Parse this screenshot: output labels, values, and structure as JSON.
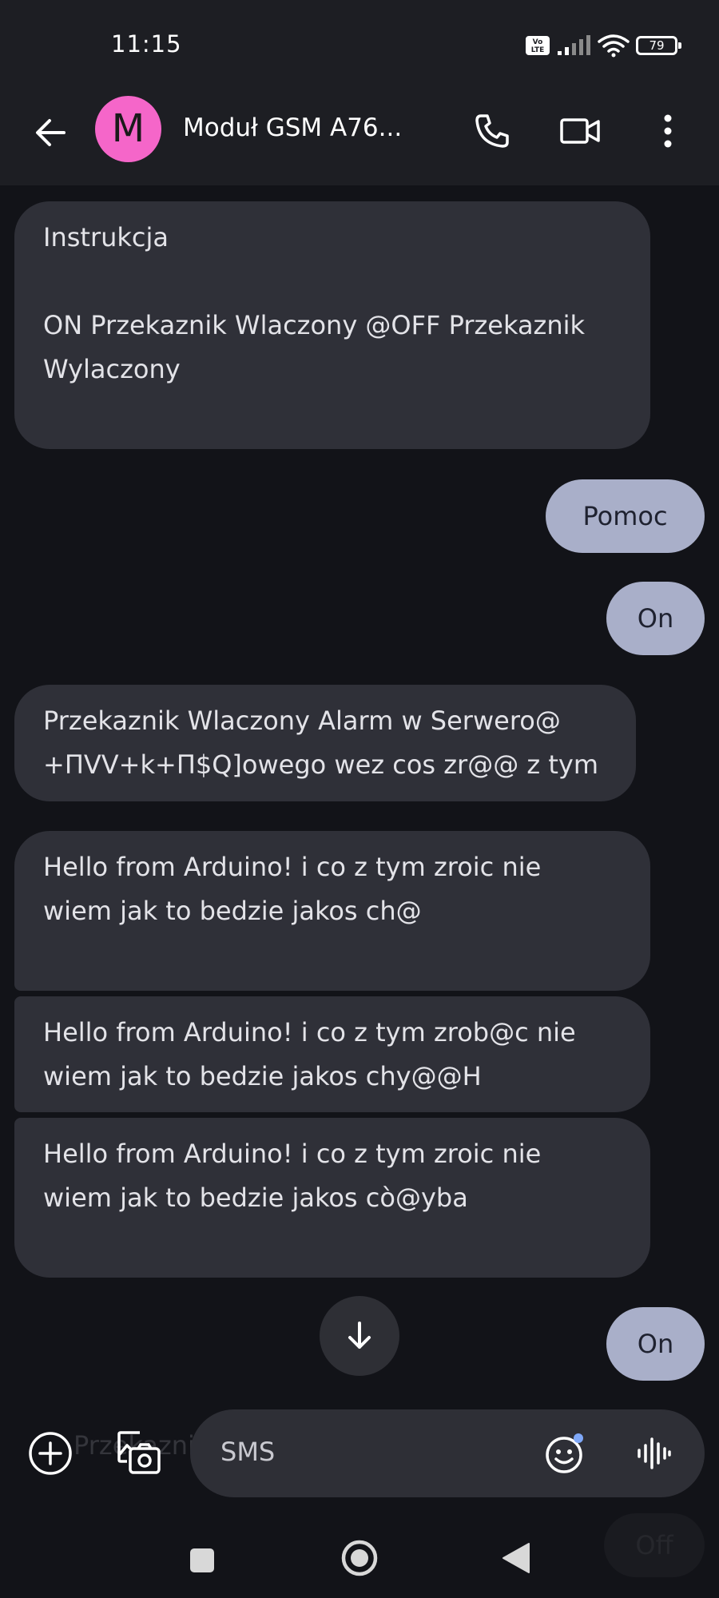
{
  "status_bar": {
    "time": "11:15",
    "volte_label": "Vo LTE",
    "battery": "79"
  },
  "header": {
    "avatar_letter": "M",
    "contact_name": "Moduł GSM A76..."
  },
  "messages": [
    {
      "direction": "incoming",
      "text": "Instrukcja\n\nON Przekaznik Wlaczony @OFF Przekaznik Wylaczony\n"
    },
    {
      "direction": "outgoing",
      "text": "Pomoc"
    },
    {
      "direction": "outgoing",
      "text": "On"
    },
    {
      "direction": "incoming",
      "text": "Przekaznik Wlaczony Alarm w Serwero@\n+ΠVV+k+Π$Q]owego wez cos zr@@ z tym"
    },
    {
      "direction": "incoming",
      "text": "Hello from Arduino! i co z tym zroic nie\nwiem jak to bedzie jakos ch@"
    },
    {
      "direction": "incoming",
      "text": "Hello from Arduino! i co z tym zrob@c nie\nwiem jak to bedzie jakos chy@@H"
    },
    {
      "direction": "incoming",
      "text": "Hello from Arduino! i co z tym zroic nie\nwiem jak to bedzie jakos cò@yba"
    },
    {
      "direction": "outgoing",
      "text": "On"
    }
  ],
  "compose": {
    "placeholder": "SMS",
    "behind_text": "Przekaznik"
  },
  "nav": {
    "behind_text": "Off"
  },
  "colors": {
    "avatar": "#f566c9",
    "outgoing_bubble": "#a9afc9",
    "incoming_bubble": "#2f3038",
    "background": "#121318"
  }
}
